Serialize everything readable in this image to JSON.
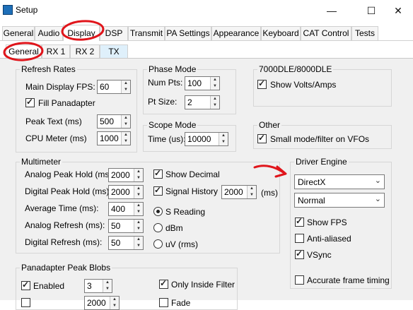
{
  "window": {
    "title": "Setup",
    "minimize": "—",
    "maximize": "☐",
    "close": "✕"
  },
  "tabs": [
    "General",
    "Audio",
    "Display",
    "DSP",
    "Transmit",
    "PA Settings",
    "Appearance",
    "Keyboard",
    "CAT Control",
    "Tests"
  ],
  "subtabs": [
    "General",
    "RX 1",
    "RX 2",
    "TX"
  ],
  "refresh_rates": {
    "title": "Refresh Rates",
    "main_fps_label": "Main Display FPS:",
    "main_fps": "60",
    "fill_panadapter": "Fill Panadapter",
    "peak_text_label": "Peak Text (ms)",
    "peak_text": "500",
    "cpu_meter_label": "CPU Meter (ms)",
    "cpu_meter": "1000"
  },
  "phase_mode": {
    "title": "Phase Mode",
    "num_pts_label": "Num Pts:",
    "num_pts": "100",
    "pt_size_label": "Pt Size:",
    "pt_size": "2"
  },
  "model": {
    "title": "7000DLE/8000DLE",
    "show_volts": "Show Volts/Amps"
  },
  "scope_mode": {
    "title": "Scope Mode",
    "time_label": "Time (us):",
    "time": "10000"
  },
  "other": {
    "title": "Other",
    "small_mode": "Small mode/filter on VFOs"
  },
  "multimeter": {
    "title": "Multimeter",
    "analog_peak_label": "Analog Peak Hold (ms):",
    "analog_peak": "2000",
    "digital_peak_label": "Digital Peak Hold (ms):",
    "digital_peak": "2000",
    "avg_time_label": "Average Time (ms):",
    "avg_time": "400",
    "analog_refresh_label": "Analog Refresh (ms):",
    "analog_refresh": "50",
    "digital_refresh_label": "Digital Refresh (ms):",
    "digital_refresh": "50",
    "show_decimal": "Show Decimal",
    "signal_history": "Signal History",
    "signal_history_val": "2000",
    "signal_history_unit": "(ms)",
    "s_reading": "S Reading",
    "dbm": "dBm",
    "uv": "uV (rms)"
  },
  "driver_engine": {
    "title": "Driver Engine",
    "engine": "DirectX",
    "quality": "Normal",
    "show_fps": "Show FPS",
    "anti_aliased": "Anti-aliased",
    "vsync": "VSync",
    "accurate_timing": "Accurate frame timing"
  },
  "blobs": {
    "title": "Panadapter Peak Blobs",
    "enabled": "Enabled",
    "count": "3",
    "only_inside": "Only Inside Filter",
    "peak_hold_val": "2000",
    "fade": "Fade"
  },
  "colors": {
    "annotation": "#e0151b"
  }
}
